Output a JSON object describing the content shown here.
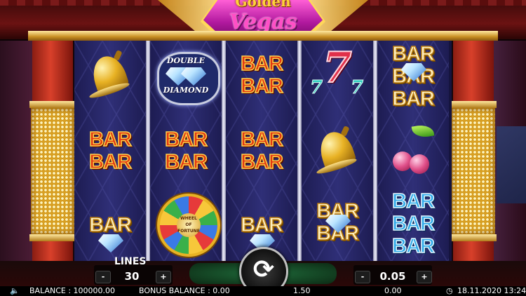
{
  "game": {
    "logo_line1": "Golden",
    "logo_line2": "Vegas"
  },
  "reels": [
    [
      "bell",
      "BAR BAR red",
      "BAR diamond gold"
    ],
    [
      "double diamond",
      "BAR BAR red",
      "wheel of fortune"
    ],
    [
      "BAR BAR red",
      "BAR BAR red",
      "BAR diamond gold"
    ],
    [
      "seven 777",
      "bell",
      "BAR BAR diamond gold"
    ],
    [
      "BAR BAR BAR diamond gold",
      "cherries",
      "BAR BAR BAR blue"
    ]
  ],
  "symbol_text": {
    "bar": "BAR",
    "double": "DOUBLE",
    "diamond_word": "DIAMOND",
    "seven": "7",
    "seven_small": "7",
    "wheel_top": "WHEEL",
    "wheel_of": "OF",
    "wheel_bottom": "FORTUNE"
  },
  "controls": {
    "lines_label": "LINES",
    "lines_value": "30",
    "bet_value": "0.05",
    "minus": "-",
    "plus": "+",
    "spin_icon": "refresh-icon"
  },
  "status": {
    "balance": "BALANCE : 100000.00",
    "bonus_balance": "BONUS BALANCE : 0.00",
    "bet": "1.50",
    "win": "0.00",
    "datetime": "18.11.2020 13:24"
  },
  "colors": {
    "reel_bg": "#1d1c52",
    "bar_red": "#e23a12",
    "bar_gold": "#fff1c0",
    "bar_blue": "#2fa9e8",
    "logo_pink": "#ff4fc6",
    "gold": "#e8b224"
  }
}
